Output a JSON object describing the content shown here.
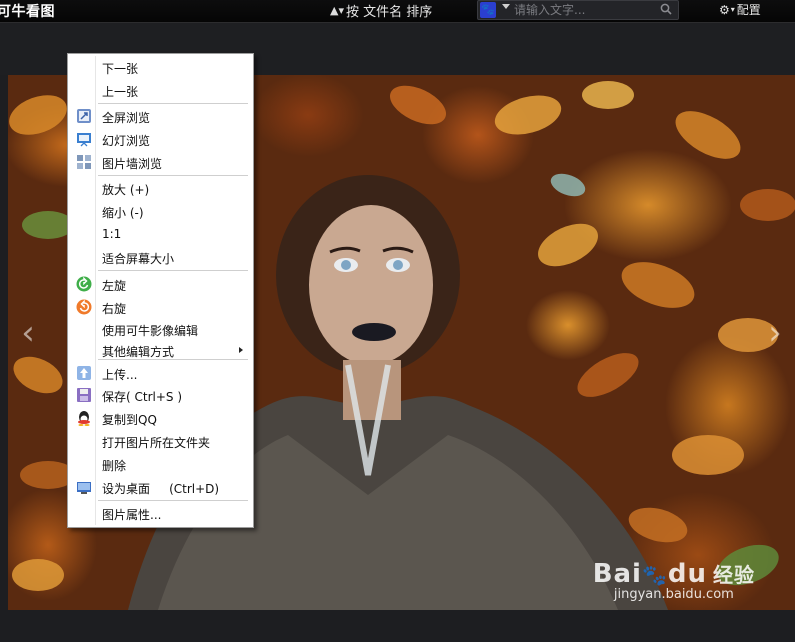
{
  "app": {
    "title": "可牛看图"
  },
  "toolbar": {
    "sort_label": "按 文件名 排序",
    "config_label": "配置"
  },
  "search": {
    "engine_glyph": "🐾",
    "placeholder": "请输入文字...",
    "value": ""
  },
  "photo": {
    "watermark_brand": "Bai",
    "watermark_brand2": "du",
    "watermark_jy": "经验",
    "watermark_url": "jingyan.baidu.com"
  },
  "context_menu": {
    "items": [
      {
        "label": "下一张",
        "icon": ""
      },
      {
        "label": "上一张",
        "icon": ""
      },
      {
        "label": "全屏浏览",
        "icon": "fullscreen-icon"
      },
      {
        "label": "幻灯浏览",
        "icon": "slideshow-icon"
      },
      {
        "label": "图片墙浏览",
        "icon": "picture-wall-icon"
      },
      {
        "label": "放大 (+)",
        "icon": ""
      },
      {
        "label": "缩小 (-)",
        "icon": ""
      },
      {
        "label": "1:1",
        "icon": ""
      },
      {
        "label": "适合屏幕大小",
        "icon": ""
      },
      {
        "label": "左旋",
        "icon": "rotate-left-icon"
      },
      {
        "label": "右旋",
        "icon": "rotate-right-icon"
      },
      {
        "label": "使用可牛影像编辑",
        "icon": ""
      },
      {
        "label": "其他编辑方式",
        "icon": "",
        "submenu": true
      },
      {
        "label": "上传...",
        "icon": "upload-icon"
      },
      {
        "label": "保存( Ctrl+S )",
        "icon": "save-icon"
      },
      {
        "label": "复制到QQ",
        "icon": "qq-icon"
      },
      {
        "label": "打开图片所在文件夹",
        "icon": ""
      },
      {
        "label": "删除",
        "icon": ""
      },
      {
        "label": "设为桌面     (Ctrl+D)",
        "icon": "desktop-icon"
      },
      {
        "label": "图片属性...",
        "icon": ""
      }
    ]
  },
  "colors": {
    "background": "#1d1e21",
    "menu_bg": "#ffffff",
    "accent_blue": "#2b3fd0"
  }
}
